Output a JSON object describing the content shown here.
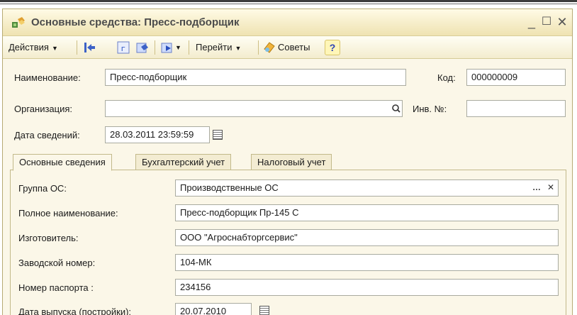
{
  "window": {
    "title": "Основные средства: Пресс-подборщик",
    "minimize": "_",
    "maximize": "☐",
    "close": "✕"
  },
  "toolbar": {
    "actions_label": "Действия",
    "goto_label": "Перейти",
    "tips_label": "Советы",
    "help_label": "?"
  },
  "header": {
    "name_label": "Наименование:",
    "name_value": "Пресс-подборщик",
    "code_label": "Код:",
    "code_value": "000000009",
    "org_label": "Организация:",
    "org_value": "",
    "inv_label": "Инв. №:",
    "inv_value": "",
    "date_label": "Дата сведений:",
    "date_value": "28.03.2011 23:59:59"
  },
  "tabs": [
    {
      "label": "Основные сведения"
    },
    {
      "label": "Бухгалтерский учет"
    },
    {
      "label": "Налоговый учет"
    }
  ],
  "main": {
    "group_label": "Группа ОС:",
    "group_value": "Производственные ОС",
    "fullname_label": "Полное наименование:",
    "fullname_value": "Пресс-подборщик Пр-145 С",
    "maker_label": "Изготовитель:",
    "maker_value": "ООО \"Агроснабторгсервис\"",
    "serial_label": "Заводской номер:",
    "serial_value": "104-МК",
    "passport_label": "Номер паспорта :",
    "passport_value": "234156",
    "release_label": "Дата выпуска (постройки):",
    "release_value": "20.07.2010"
  },
  "colors": {
    "window_bg": "#fbf7e8",
    "title_text": "#4b4b4b",
    "help_blue": "#2d43b5"
  }
}
